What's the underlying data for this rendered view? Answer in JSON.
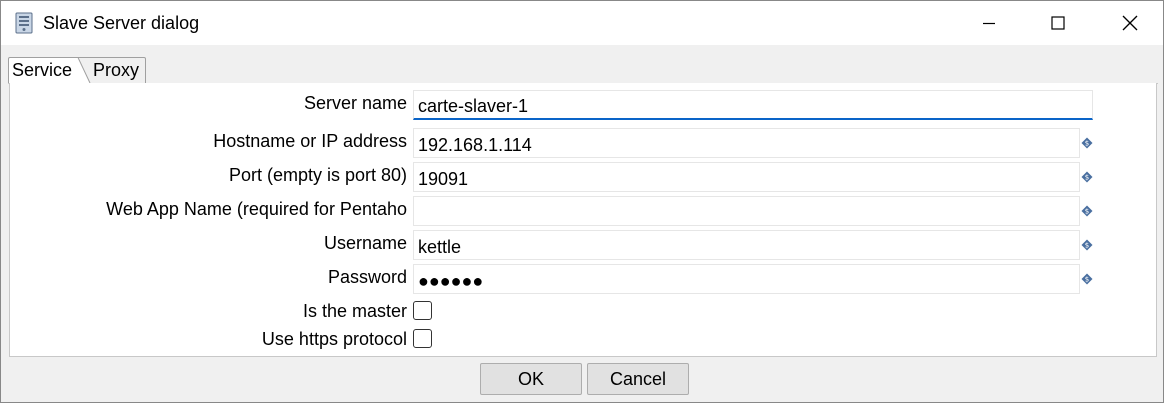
{
  "window": {
    "title": "Slave Server dialog",
    "icons": {
      "app": "server-icon",
      "minimize": "minimize-icon",
      "maximize": "maximize-icon",
      "close": "close-icon"
    }
  },
  "tabs": [
    {
      "label": "Service",
      "selected": true
    },
    {
      "label": "Proxy",
      "selected": false
    }
  ],
  "form": {
    "server_name": {
      "label": "Server name",
      "value": "carte-slaver-1"
    },
    "hostname": {
      "label": "Hostname or IP address",
      "value": "192.168.1.114"
    },
    "port": {
      "label": "Port (empty is port 80)",
      "value": "19091"
    },
    "webapp": {
      "label": "Web App Name (required for Pentaho",
      "value": ""
    },
    "username": {
      "label": "Username",
      "value": "kettle"
    },
    "password": {
      "label": "Password",
      "value": "●●●●●●"
    },
    "is_master": {
      "label": "Is the master",
      "checked": false
    },
    "use_https": {
      "label": "Use https protocol",
      "checked": false
    },
    "variable_icon": "variable-diamond-icon"
  },
  "buttons": {
    "ok": "OK",
    "cancel": "Cancel"
  },
  "colors": {
    "focus_underline": "#0a64c8",
    "variable_icon": "#4a6fa0"
  }
}
